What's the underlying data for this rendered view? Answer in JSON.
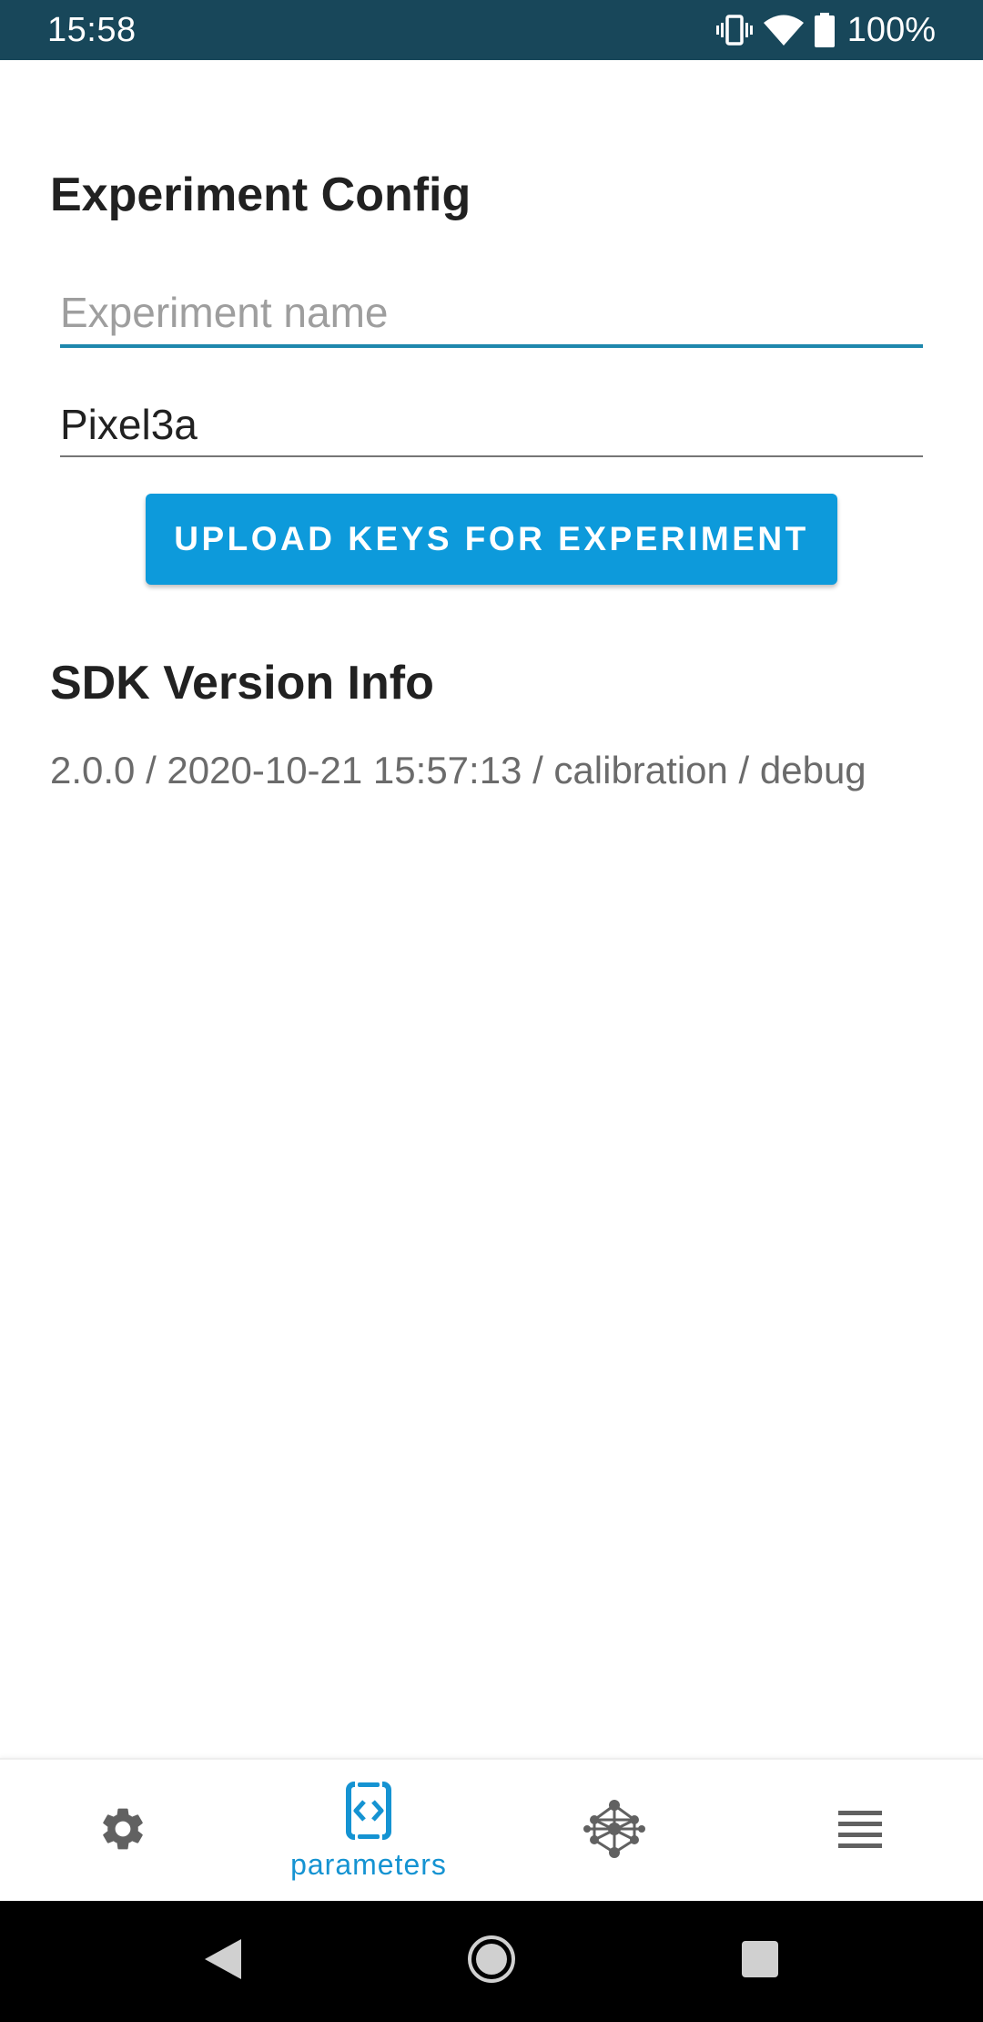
{
  "status_bar": {
    "time": "15:58",
    "battery": "100%",
    "icons": [
      "vibrate-icon",
      "wifi-icon",
      "battery-icon"
    ]
  },
  "experiment_config": {
    "title": "Experiment Config",
    "name_field": {
      "placeholder": "Experiment name",
      "value": ""
    },
    "device_field": {
      "value": "Pixel3a"
    },
    "upload_button_label": "UPLOAD KEYS FOR EXPERIMENT"
  },
  "sdk_info": {
    "title": "SDK Version Info",
    "version_text": "2.0.0 / 2020-10-21 15:57:13 / calibration / debug"
  },
  "bottom_nav": {
    "items": [
      {
        "icon": "gear-icon",
        "label": "",
        "active": false
      },
      {
        "icon": "parameters-icon",
        "label": "parameters",
        "active": true
      },
      {
        "icon": "network-icon",
        "label": "",
        "active": false
      },
      {
        "icon": "list-icon",
        "label": "",
        "active": false
      }
    ]
  },
  "colors": {
    "status_bar": "#18475a",
    "accent": "#0d9adb",
    "active_underline": "#1e87ad",
    "nav_active": "#1593d2",
    "nav_inactive": "#616161"
  }
}
